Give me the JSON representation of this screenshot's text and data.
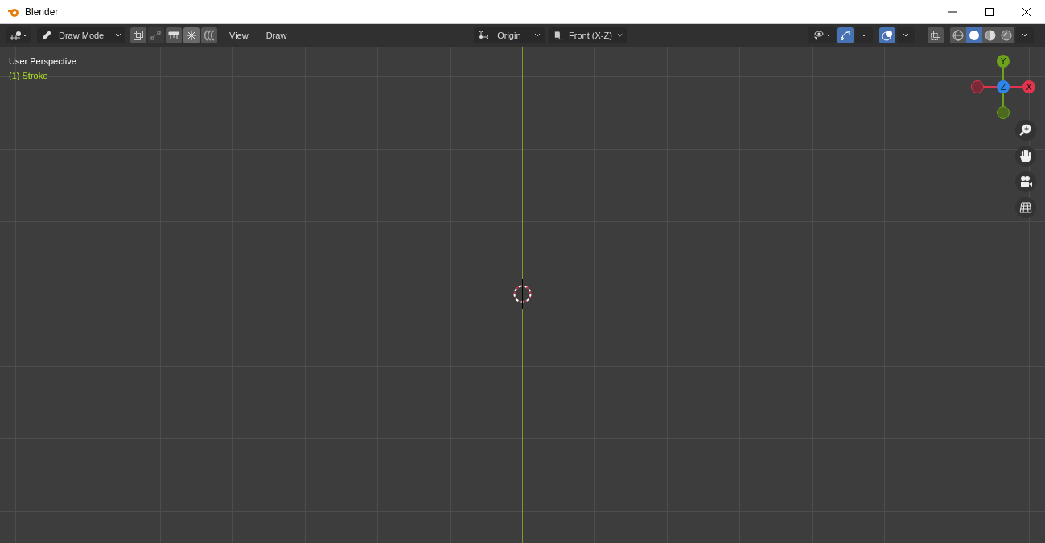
{
  "window": {
    "title": "Blender"
  },
  "header": {
    "mode": "Draw Mode",
    "menus": [
      "View",
      "Draw"
    ],
    "pivot": "Origin",
    "orientation": "Front (X-Z)",
    "toggles": [
      {
        "kind": "gizmo",
        "on": true
      },
      {
        "kind": "overlay",
        "on": true
      }
    ],
    "shading": [
      {
        "kind": "wireframe",
        "selected": false
      },
      {
        "kind": "solid",
        "selected": true
      },
      {
        "kind": "material",
        "selected": false
      },
      {
        "kind": "rendered",
        "selected": false
      }
    ]
  },
  "viewport": {
    "view_name": "User Perspective",
    "object_name": "(1) Stroke",
    "gizmo_axes": [
      {
        "label": "Y",
        "color": "#6ea21a"
      },
      {
        "label": "Z",
        "color": "#2f85e3"
      },
      {
        "label": "X",
        "color": "#e0344f"
      }
    ]
  }
}
